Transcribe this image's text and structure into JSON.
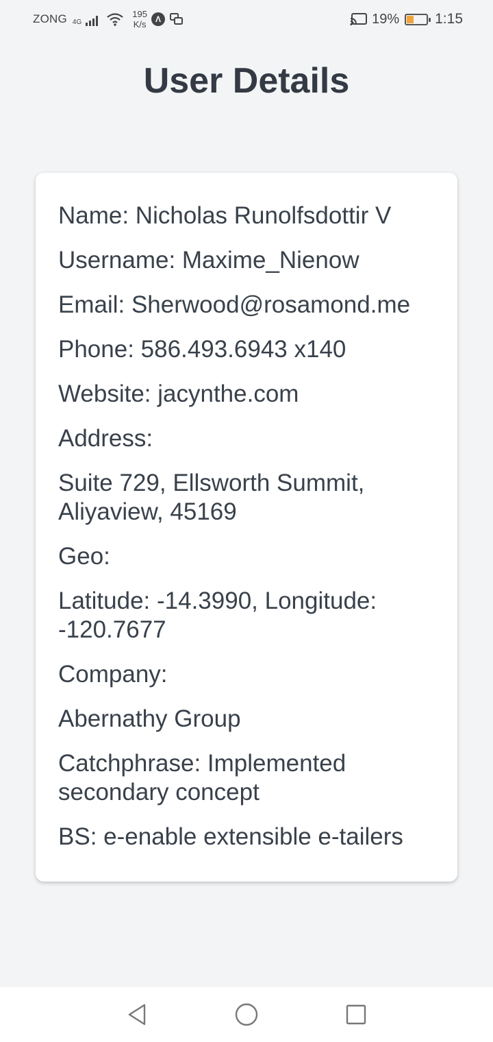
{
  "status_bar": {
    "carrier": "ZONG",
    "network_type": "4G",
    "speed_value": "195",
    "speed_unit": "K/s",
    "battery_percent": "19%",
    "time": "1:15"
  },
  "page": {
    "title": "User Details"
  },
  "user": {
    "name": "Name: Nicholas Runolfsdottir V",
    "username": "Username: Maxime_Nienow",
    "email": "Email: Sherwood@rosamond.me",
    "phone": "Phone: 586.493.6943 x140",
    "website": "Website: jacynthe.com",
    "address_label": "Address:",
    "address": "Suite 729, Ellsworth Summit, Aliyaview, 45169",
    "geo_label": "Geo:",
    "geo": "Latitude: -14.3990, Longitude: -120.7677",
    "company_label": "Company:",
    "company_name": "Abernathy Group",
    "catchphrase": "Catchphrase: Implemented secondary concept",
    "bs": "BS: e-enable extensible e-tailers"
  },
  "icons": {
    "signal": "signal-icon",
    "wifi": "wifi-icon",
    "app_a": "app-a-icon",
    "screen_share": "screen-share-icon",
    "cast": "cast-icon",
    "battery": "battery-icon",
    "back": "back-icon",
    "home": "home-icon",
    "recent": "recent-apps-icon"
  },
  "colors": {
    "background": "#f3f4f6",
    "card": "#ffffff",
    "text": "#39414b",
    "battery_fill": "#f2a23a"
  }
}
